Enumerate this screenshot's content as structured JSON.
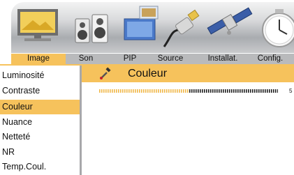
{
  "tabs": [
    {
      "label": "Image",
      "active": true
    },
    {
      "label": "Son",
      "active": false
    },
    {
      "label": "PIP",
      "active": false
    },
    {
      "label": "Source",
      "active": false
    },
    {
      "label": "Installat.",
      "active": false
    },
    {
      "label": "Config.",
      "active": false
    }
  ],
  "menu_icons": [
    "tv-monitor-icon",
    "speakers-icon",
    "pip-screens-icon",
    "cable-plug-icon",
    "satellite-icon",
    "clock-icon"
  ],
  "submenu": {
    "items": [
      {
        "label": "Luminosité",
        "selected": false
      },
      {
        "label": "Contraste",
        "selected": false
      },
      {
        "label": "Couleur",
        "selected": true
      },
      {
        "label": "Nuance",
        "selected": false
      },
      {
        "label": "Netteté",
        "selected": false
      },
      {
        "label": "NR",
        "selected": false
      },
      {
        "label": "Temp.Coul.",
        "selected": false
      }
    ]
  },
  "panel": {
    "title": "Couleur",
    "icon": "color-picker-icon",
    "slider_value_label": "5",
    "slider_level": 0.5
  },
  "colors": {
    "accent": "#f6c25c",
    "tab_bar": "#b9babc",
    "slider_empty": "#f0b84a",
    "slider_filled": "#222222"
  }
}
